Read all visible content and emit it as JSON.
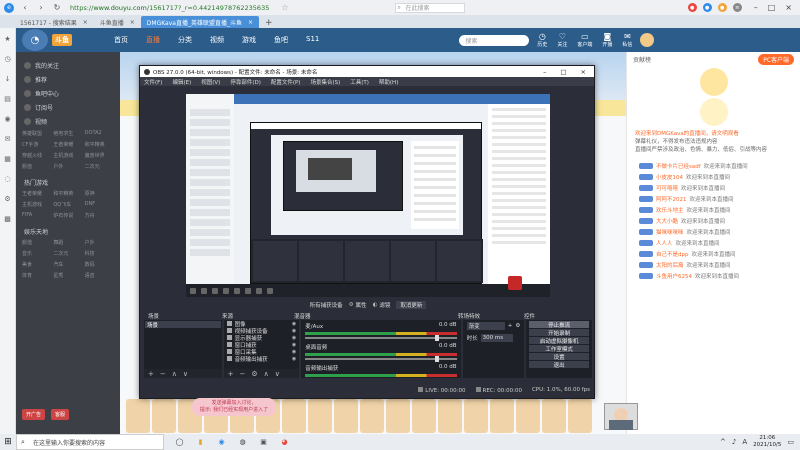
{
  "browser": {
    "url_prefix": "https://",
    "url_host": "www.douyu.com",
    "url_path": "/1561717?_r=0.44214978762235635",
    "search_placeholder": "在此搜索",
    "tabs": [
      {
        "label": "1561717 - 搜索结果",
        "active": false
      },
      {
        "label": "斗鱼直播",
        "active": false
      },
      {
        "label": "DMGKava直播_英雄联盟直播_斗鱼",
        "active": true
      }
    ]
  },
  "site": {
    "logo_text": "斗鱼",
    "nav": [
      "首页",
      "直播",
      "分类",
      "视频",
      "游戏",
      "鱼吧",
      "S11"
    ],
    "nav_active_index": 1,
    "search_placeholder": "搜索",
    "header_icons": [
      "历史",
      "关注",
      "客户端",
      "开播",
      "私信"
    ],
    "left_menu_top": [
      "我的关注",
      "推荐",
      "鱼吧中心",
      "订阅号",
      "视频"
    ],
    "left_grid_1": [
      "英雄联盟",
      "绝地求生",
      "DOTA2",
      "CF手游",
      "王者荣耀",
      "和平精英",
      "穿越火线",
      "主机游戏",
      "魔兽世界",
      "颜值",
      "户外",
      "二次元"
    ],
    "left_section_2": "热门游戏",
    "left_grid_2": [
      "王者荣耀",
      "和平精英",
      "原神",
      "主机游戏",
      "QQ飞车",
      "DNF",
      "FIFA",
      "炉石传说",
      "方舟"
    ],
    "left_section_3": "娱乐天地",
    "left_grid_3": [
      "颜值",
      "舞蹈",
      "户外",
      "音乐",
      "二次元",
      "科技",
      "美食",
      "汽车",
      "数码",
      "体育",
      "星秀",
      "语音"
    ],
    "left_bottom_btns": [
      "开广告",
      "客服"
    ],
    "right_tab": "贡献榜",
    "right_btn": "PC客户端",
    "notice_lines": [
      "欢迎来到DMGKava的直播间，请文明观看",
      "弹幕礼仪，不得发布违法违规内容",
      "直播间严禁涉及政治、色情、暴力、低俗、引战等内容"
    ],
    "chat": [
      {
        "name": "不做卡片已经sadf",
        "text": "欢迎来到本直播间"
      },
      {
        "name": "小皮皮104",
        "text": "欢迎来到本直播间"
      },
      {
        "name": "可可嘻嘻",
        "text": "欢迎来到本直播间"
      },
      {
        "name": "阿阿不2021",
        "text": "欢迎来到本直播间"
      },
      {
        "name": "欢乐斗地主",
        "text": "欢迎来到本直播间"
      },
      {
        "name": "大大小酷",
        "text": "欢迎来到本直播间"
      },
      {
        "name": "猫咪咪咪咪",
        "text": "欢迎来到本直播间"
      },
      {
        "name": "人人人",
        "text": "欢迎来到本直播间"
      },
      {
        "name": "自己不是dpp",
        "text": "欢迎来到本直播间"
      },
      {
        "name": "太阳的后裔",
        "text": "欢迎来到本直播间"
      },
      {
        "name": "斗鱼用户6254",
        "text": "欢迎来到本直播间"
      }
    ]
  },
  "obs": {
    "title": "OBS 27.0.0 (64-bit, windows) - 配置文件: 未命名 - 场景: 未命名",
    "menu": [
      "文件(F)",
      "编辑(E)",
      "视图(V)",
      "停靠部件(D)",
      "配置文件(P)",
      "场景集合(S)",
      "工具(T)",
      "帮助(H)"
    ],
    "ctrlbar": {
      "source_label": "所有捕获设备",
      "props": "属性",
      "filters": "滤镜",
      "capture_btn": "取消更新"
    },
    "panel_headers": [
      "场景",
      "来源",
      "混音器",
      "转场特效",
      "控件"
    ],
    "scenes": [
      "场景"
    ],
    "sources": [
      "图像",
      "视频捕获设备",
      "显示器捕获",
      "窗口捕获",
      "窗口采集",
      "音频输出捕获"
    ],
    "mixer": [
      {
        "name": "麦/Aux",
        "db": "0.0 dB"
      },
      {
        "name": "桌面音频",
        "db": "0.0 dB"
      },
      {
        "name": "音频输出捕获",
        "db": "0.0 dB"
      }
    ],
    "transition": {
      "name": "渐变",
      "duration_label": "时长",
      "duration": "300 ms"
    },
    "controls": [
      "停止推流",
      "开始录制",
      "启动虚拟摄像机",
      "工作室模式",
      "设置",
      "退出"
    ],
    "status": {
      "live": "LIVE: 00:00:00",
      "rec": "REC: 00:00:00",
      "cpu": "CPU: 1.0%, 60.00 fps"
    }
  },
  "overlay": {
    "pink_line1": "发送弹幕加入讨论，",
    "pink_line2": "提示: 我们已经实现用户进入了"
  },
  "taskbar": {
    "search_placeholder": "在这里输入你要搜索的内容",
    "time": "21:06",
    "date": "2021/10/5",
    "tray_icons": [
      "^",
      "♪",
      "A"
    ]
  }
}
